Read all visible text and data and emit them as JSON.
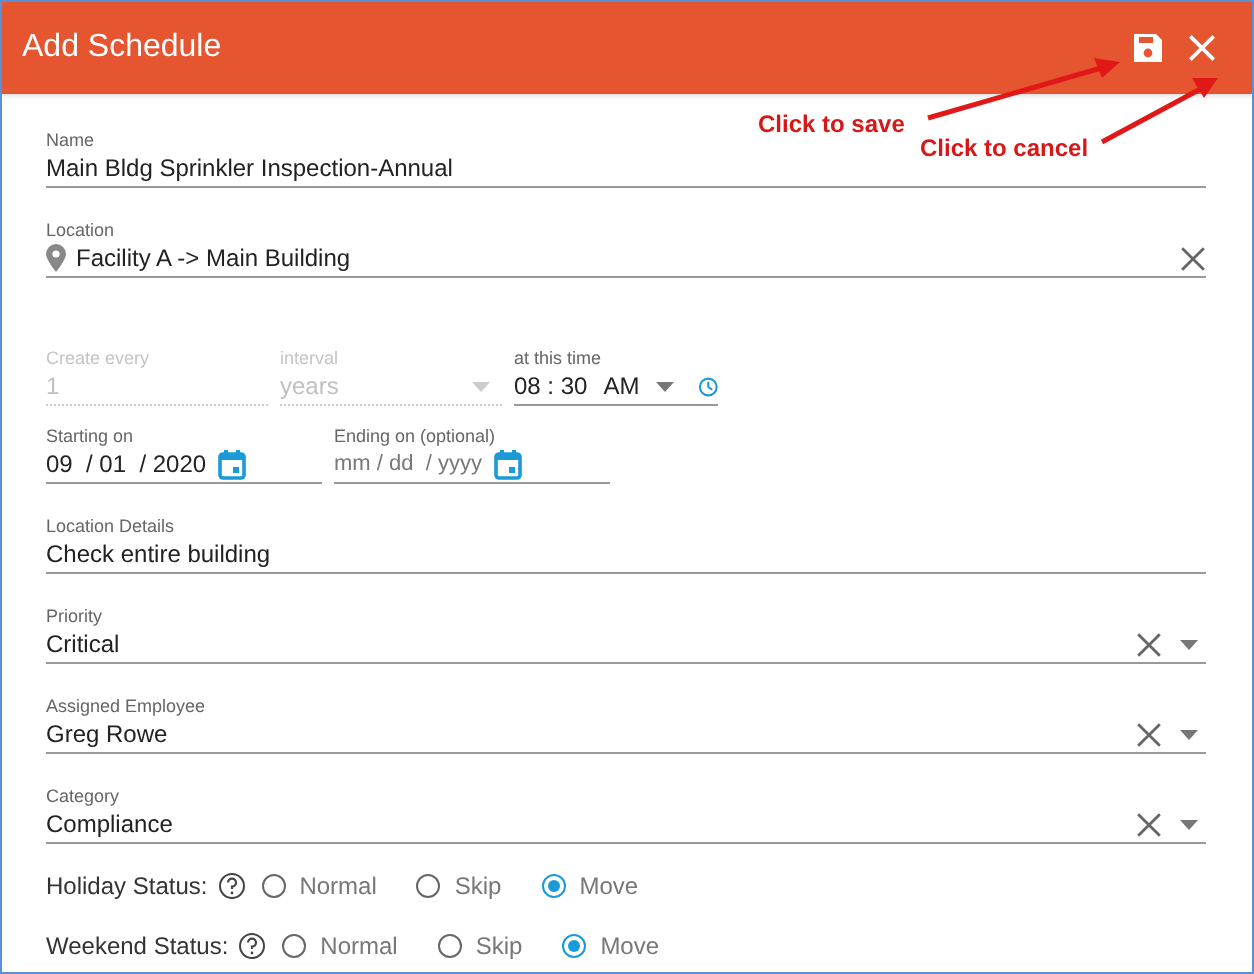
{
  "title": "Add Schedule",
  "annotations": [
    {
      "text": "Click to save"
    },
    {
      "text": "Click to cancel"
    }
  ],
  "name": {
    "label": "Name",
    "value": "Main Bldg Sprinkler Inspection-Annual"
  },
  "location": {
    "label": "Location",
    "value": "Facility A -> Main Building"
  },
  "recurrence": [
    {
      "label": "Create every",
      "value": "1",
      "disabled": true,
      "kind": "text"
    },
    {
      "label": "interval",
      "value": "years",
      "disabled": true,
      "kind": "select"
    }
  ],
  "time": {
    "label": "at this time",
    "value": "08 : 30",
    "period": "AM"
  },
  "dates": [
    {
      "label": "Starting on",
      "value": "09  / 01  / 2020"
    },
    {
      "label": "Ending on (optional)",
      "placeholder": "mm / dd  / yyyy"
    }
  ],
  "location_details": {
    "label": "Location Details",
    "value": "Check entire building"
  },
  "selects": [
    {
      "label": "Priority",
      "value": "Critical"
    },
    {
      "label": "Assigned Employee",
      "value": "Greg Rowe"
    },
    {
      "label": "Category",
      "value": "Compliance"
    }
  ],
  "radio_groups": [
    {
      "label": "Holiday Status:",
      "options": [
        {
          "label": "Normal",
          "selected": false
        },
        {
          "label": "Skip",
          "selected": false
        },
        {
          "label": "Move",
          "selected": true
        }
      ]
    },
    {
      "label": "Weekend Status:",
      "options": [
        {
          "label": "Normal",
          "selected": false
        },
        {
          "label": "Skip",
          "selected": false
        },
        {
          "label": "Move",
          "selected": true
        }
      ]
    }
  ]
}
